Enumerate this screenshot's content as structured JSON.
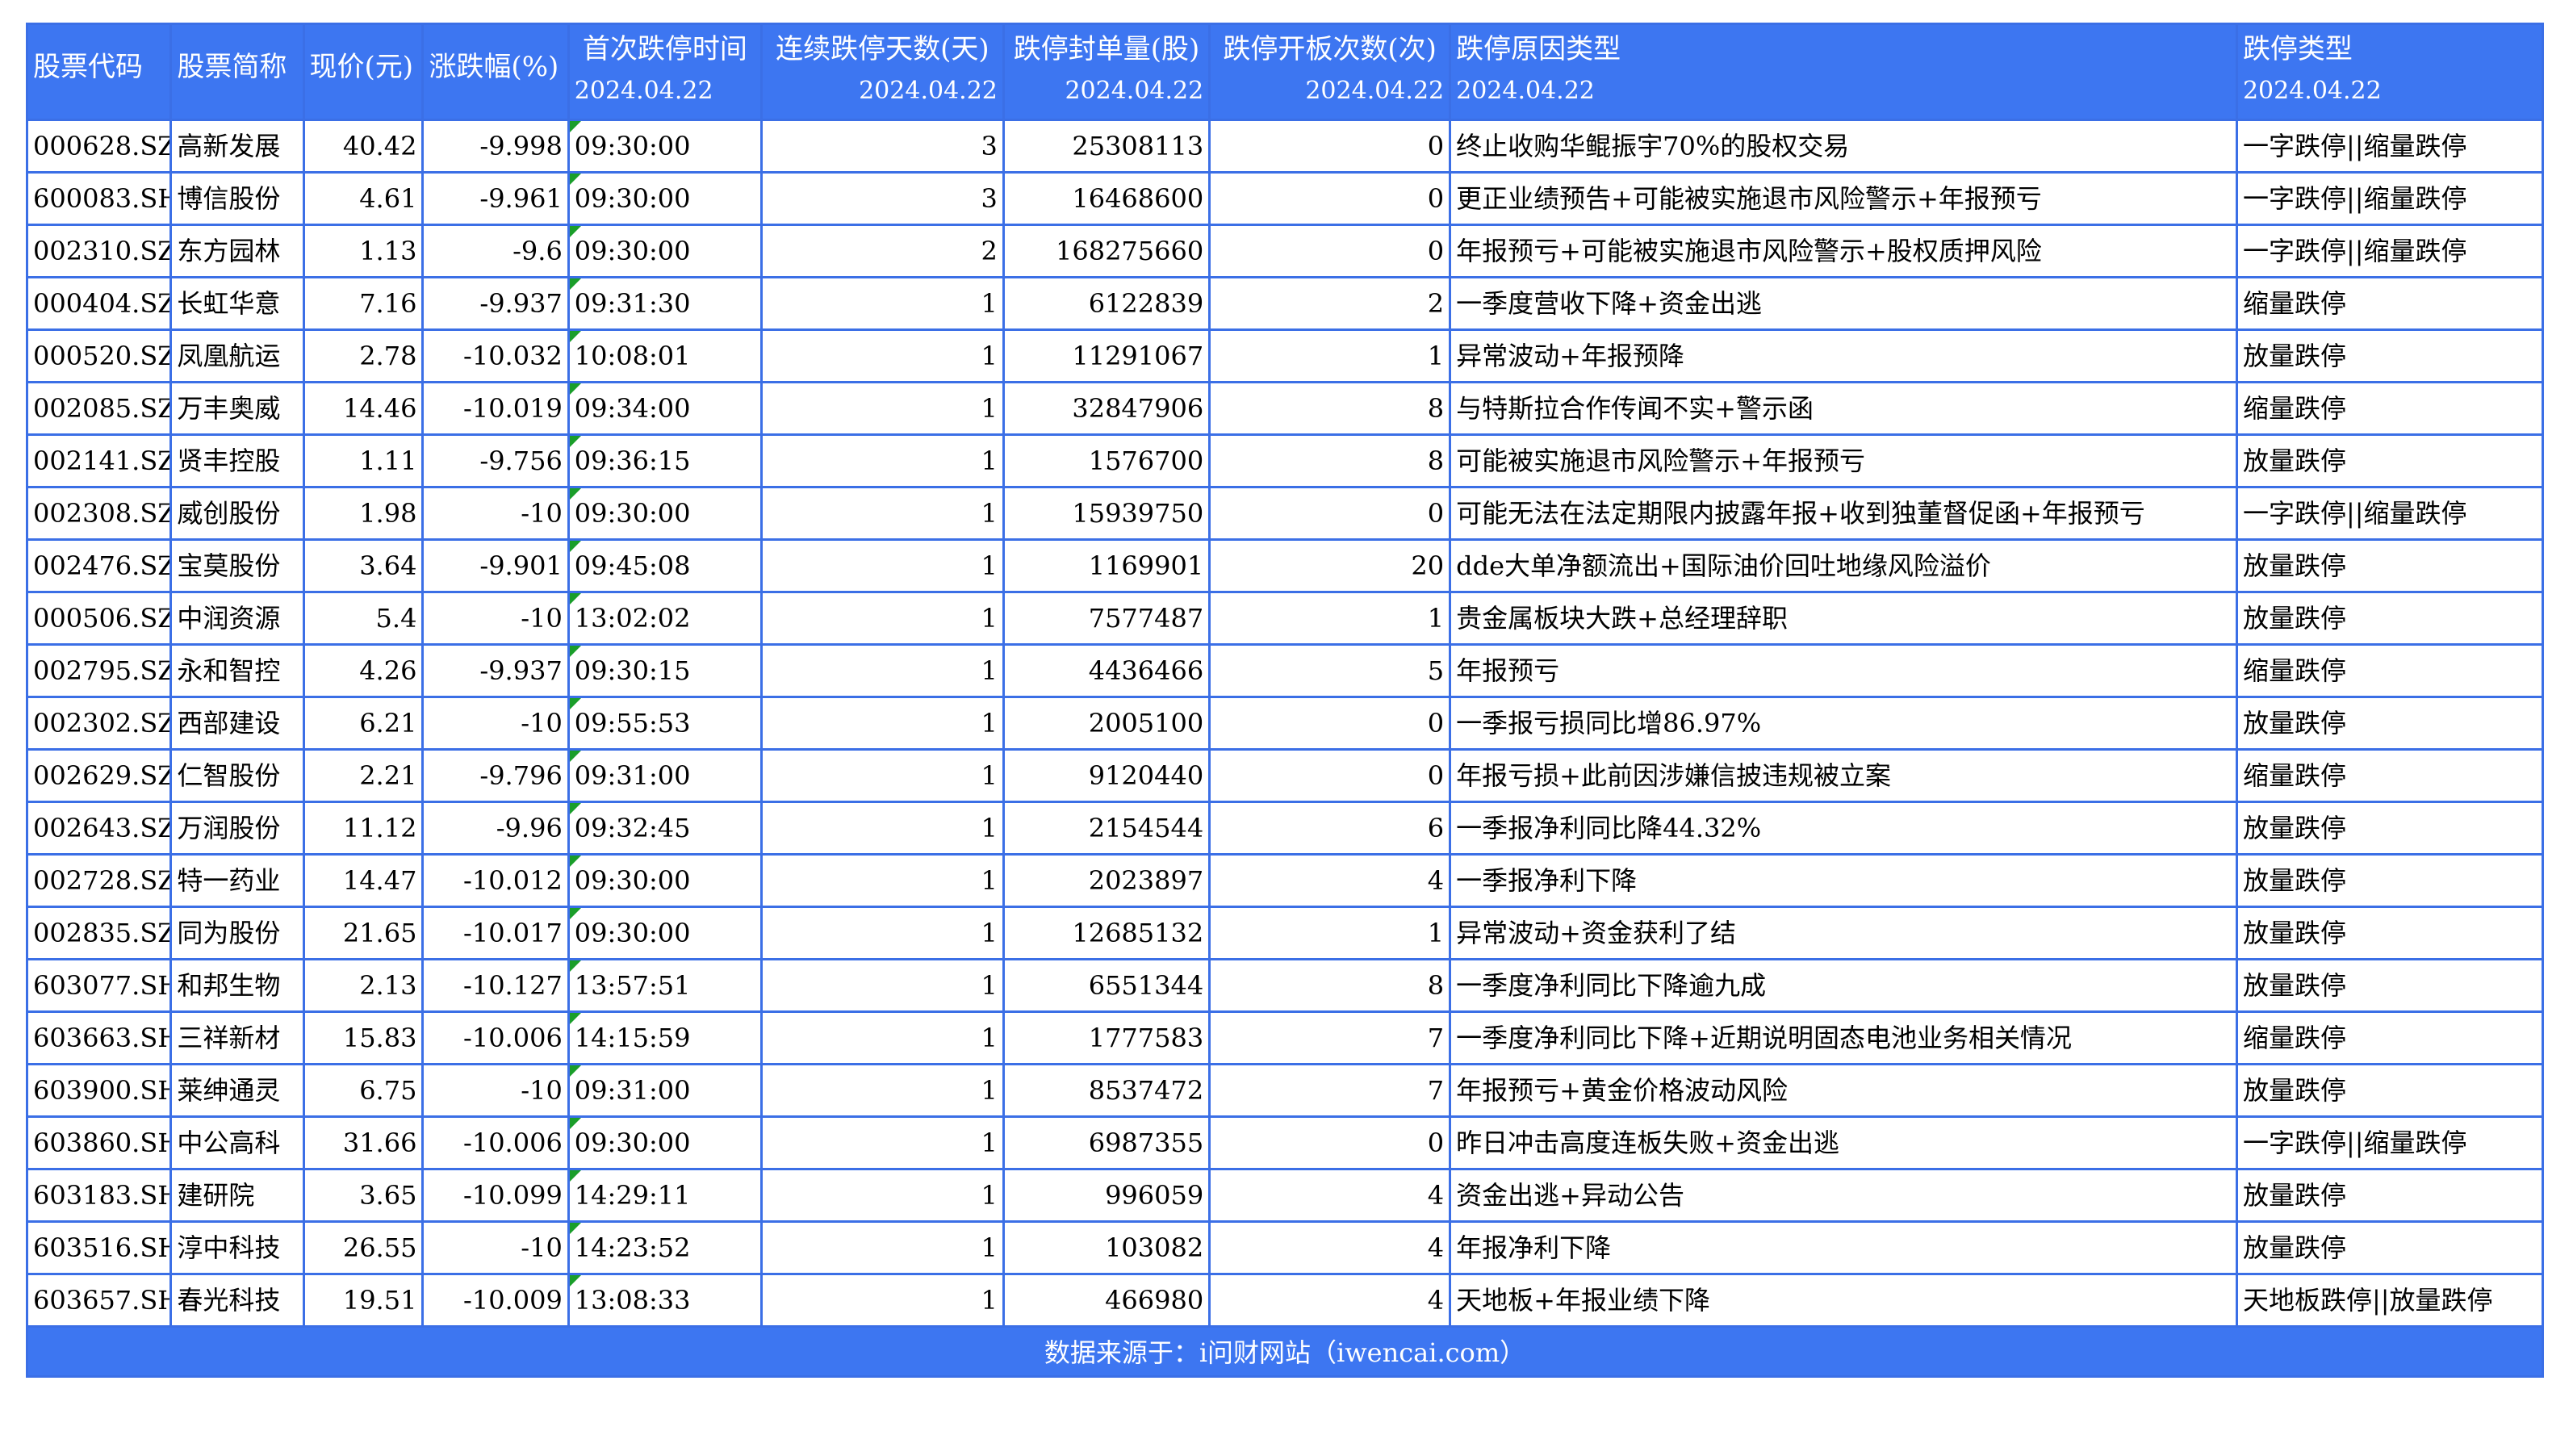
{
  "header": {
    "columns": [
      {
        "name": "股票代码",
        "date": ""
      },
      {
        "name": "股票简称",
        "date": ""
      },
      {
        "name": "现价(元)",
        "date": ""
      },
      {
        "name": "涨跌幅(%)",
        "date": ""
      },
      {
        "name": "首次跌停时间",
        "date": "2024.04.22"
      },
      {
        "name": "连续跌停天数(天)",
        "date": "2024.04.22"
      },
      {
        "name": "跌停封单量(股)",
        "date": "2024.04.22"
      },
      {
        "name": "跌停开板次数(次)",
        "date": "2024.04.22"
      },
      {
        "name": "跌停原因类型",
        "date": "2024.04.22"
      },
      {
        "name": "跌停类型",
        "date": "2024.04.22"
      }
    ]
  },
  "rows": [
    {
      "code": "000628.SZ",
      "name": "高新发展",
      "price": "40.42",
      "change": "-9.998",
      "time": "09:30:00",
      "days": "3",
      "seal": "25308113",
      "opens": "0",
      "reason": "终止收购华鲲振宇70%的股权交易",
      "type": "一字跌停||缩量跌停"
    },
    {
      "code": "600083.SH",
      "name": "博信股份",
      "price": "4.61",
      "change": "-9.961",
      "time": "09:30:00",
      "days": "3",
      "seal": "16468600",
      "opens": "0",
      "reason": "更正业绩预告+可能被实施退市风险警示+年报预亏",
      "type": "一字跌停||缩量跌停"
    },
    {
      "code": "002310.SZ",
      "name": "东方园林",
      "price": "1.13",
      "change": "-9.6",
      "time": "09:30:00",
      "days": "2",
      "seal": "168275660",
      "opens": "0",
      "reason": "年报预亏+可能被实施退市风险警示+股权质押风险",
      "type": "一字跌停||缩量跌停"
    },
    {
      "code": "000404.SZ",
      "name": "长虹华意",
      "price": "7.16",
      "change": "-9.937",
      "time": "09:31:30",
      "days": "1",
      "seal": "6122839",
      "opens": "2",
      "reason": "一季度营收下降+资金出逃",
      "type": "缩量跌停"
    },
    {
      "code": "000520.SZ",
      "name": "凤凰航运",
      "price": "2.78",
      "change": "-10.032",
      "time": "10:08:01",
      "days": "1",
      "seal": "11291067",
      "opens": "1",
      "reason": "异常波动+年报预降",
      "type": "放量跌停"
    },
    {
      "code": "002085.SZ",
      "name": "万丰奥威",
      "price": "14.46",
      "change": "-10.019",
      "time": "09:34:00",
      "days": "1",
      "seal": "32847906",
      "opens": "8",
      "reason": "与特斯拉合作传闻不实+警示函",
      "type": "缩量跌停"
    },
    {
      "code": "002141.SZ",
      "name": "贤丰控股",
      "price": "1.11",
      "change": "-9.756",
      "time": "09:36:15",
      "days": "1",
      "seal": "1576700",
      "opens": "8",
      "reason": "可能被实施退市风险警示+年报预亏",
      "type": "放量跌停"
    },
    {
      "code": "002308.SZ",
      "name": "威创股份",
      "price": "1.98",
      "change": "-10",
      "time": "09:30:00",
      "days": "1",
      "seal": "15939750",
      "opens": "0",
      "reason": "可能无法在法定期限内披露年报+收到独董督促函+年报预亏",
      "type": "一字跌停||缩量跌停"
    },
    {
      "code": "002476.SZ",
      "name": "宝莫股份",
      "price": "3.64",
      "change": "-9.901",
      "time": "09:45:08",
      "days": "1",
      "seal": "1169901",
      "opens": "20",
      "reason": "dde大单净额流出+国际油价回吐地缘风险溢价",
      "type": "放量跌停"
    },
    {
      "code": "000506.SZ",
      "name": "中润资源",
      "price": "5.4",
      "change": "-10",
      "time": "13:02:02",
      "days": "1",
      "seal": "7577487",
      "opens": "1",
      "reason": "贵金属板块大跌+总经理辞职",
      "type": "放量跌停"
    },
    {
      "code": "002795.SZ",
      "name": "永和智控",
      "price": "4.26",
      "change": "-9.937",
      "time": "09:30:15",
      "days": "1",
      "seal": "4436466",
      "opens": "5",
      "reason": "年报预亏",
      "type": "缩量跌停"
    },
    {
      "code": "002302.SZ",
      "name": "西部建设",
      "price": "6.21",
      "change": "-10",
      "time": "09:55:53",
      "days": "1",
      "seal": "2005100",
      "opens": "0",
      "reason": "一季报亏损同比增86.97%",
      "type": "放量跌停"
    },
    {
      "code": "002629.SZ",
      "name": "仁智股份",
      "price": "2.21",
      "change": "-9.796",
      "time": "09:31:00",
      "days": "1",
      "seal": "9120440",
      "opens": "0",
      "reason": "年报亏损+此前因涉嫌信披违规被立案",
      "type": "缩量跌停"
    },
    {
      "code": "002643.SZ",
      "name": "万润股份",
      "price": "11.12",
      "change": "-9.96",
      "time": "09:32:45",
      "days": "1",
      "seal": "2154544",
      "opens": "6",
      "reason": "一季报净利同比降44.32%",
      "type": "放量跌停"
    },
    {
      "code": "002728.SZ",
      "name": "特一药业",
      "price": "14.47",
      "change": "-10.012",
      "time": "09:30:00",
      "days": "1",
      "seal": "2023897",
      "opens": "4",
      "reason": "一季报净利下降",
      "type": "放量跌停"
    },
    {
      "code": "002835.SZ",
      "name": "同为股份",
      "price": "21.65",
      "change": "-10.017",
      "time": "09:30:00",
      "days": "1",
      "seal": "12685132",
      "opens": "1",
      "reason": "异常波动+资金获利了结",
      "type": "放量跌停"
    },
    {
      "code": "603077.SH",
      "name": "和邦生物",
      "price": "2.13",
      "change": "-10.127",
      "time": "13:57:51",
      "days": "1",
      "seal": "6551344",
      "opens": "8",
      "reason": "一季度净利同比下降逾九成",
      "type": "放量跌停"
    },
    {
      "code": "603663.SH",
      "name": "三祥新材",
      "price": "15.83",
      "change": "-10.006",
      "time": "14:15:59",
      "days": "1",
      "seal": "1777583",
      "opens": "7",
      "reason": "一季度净利同比下降+近期说明固态电池业务相关情况",
      "type": "缩量跌停"
    },
    {
      "code": "603900.SH",
      "name": "莱绅通灵",
      "price": "6.75",
      "change": "-10",
      "time": "09:31:00",
      "days": "1",
      "seal": "8537472",
      "opens": "7",
      "reason": "年报预亏+黄金价格波动风险",
      "type": "放量跌停"
    },
    {
      "code": "603860.SH",
      "name": "中公高科",
      "price": "31.66",
      "change": "-10.006",
      "time": "09:30:00",
      "days": "1",
      "seal": "6987355",
      "opens": "0",
      "reason": "昨日冲击高度连板失败+资金出逃",
      "type": "一字跌停||缩量跌停"
    },
    {
      "code": "603183.SH",
      "name": "建研院",
      "price": "3.65",
      "change": "-10.099",
      "time": "14:29:11",
      "days": "1",
      "seal": "996059",
      "opens": "4",
      "reason": "资金出逃+异动公告",
      "type": "放量跌停"
    },
    {
      "code": "603516.SH",
      "name": "淳中科技",
      "price": "26.55",
      "change": "-10",
      "time": "14:23:52",
      "days": "1",
      "seal": "103082",
      "opens": "4",
      "reason": "年报净利下降",
      "type": "放量跌停"
    },
    {
      "code": "603657.SH",
      "name": "春光科技",
      "price": "19.51",
      "change": "-10.009",
      "time": "13:08:33",
      "days": "1",
      "seal": "466980",
      "opens": "4",
      "reason": "天地板+年报业绩下降",
      "type": "天地板跌停||放量跌停"
    }
  ],
  "footer": {
    "source": "数据来源于：i问财网站（iwencai.com）"
  },
  "colors": {
    "header_bg": "#3d76f1",
    "border": "#3b6fe6",
    "time_flag": "#1a9e2a"
  }
}
